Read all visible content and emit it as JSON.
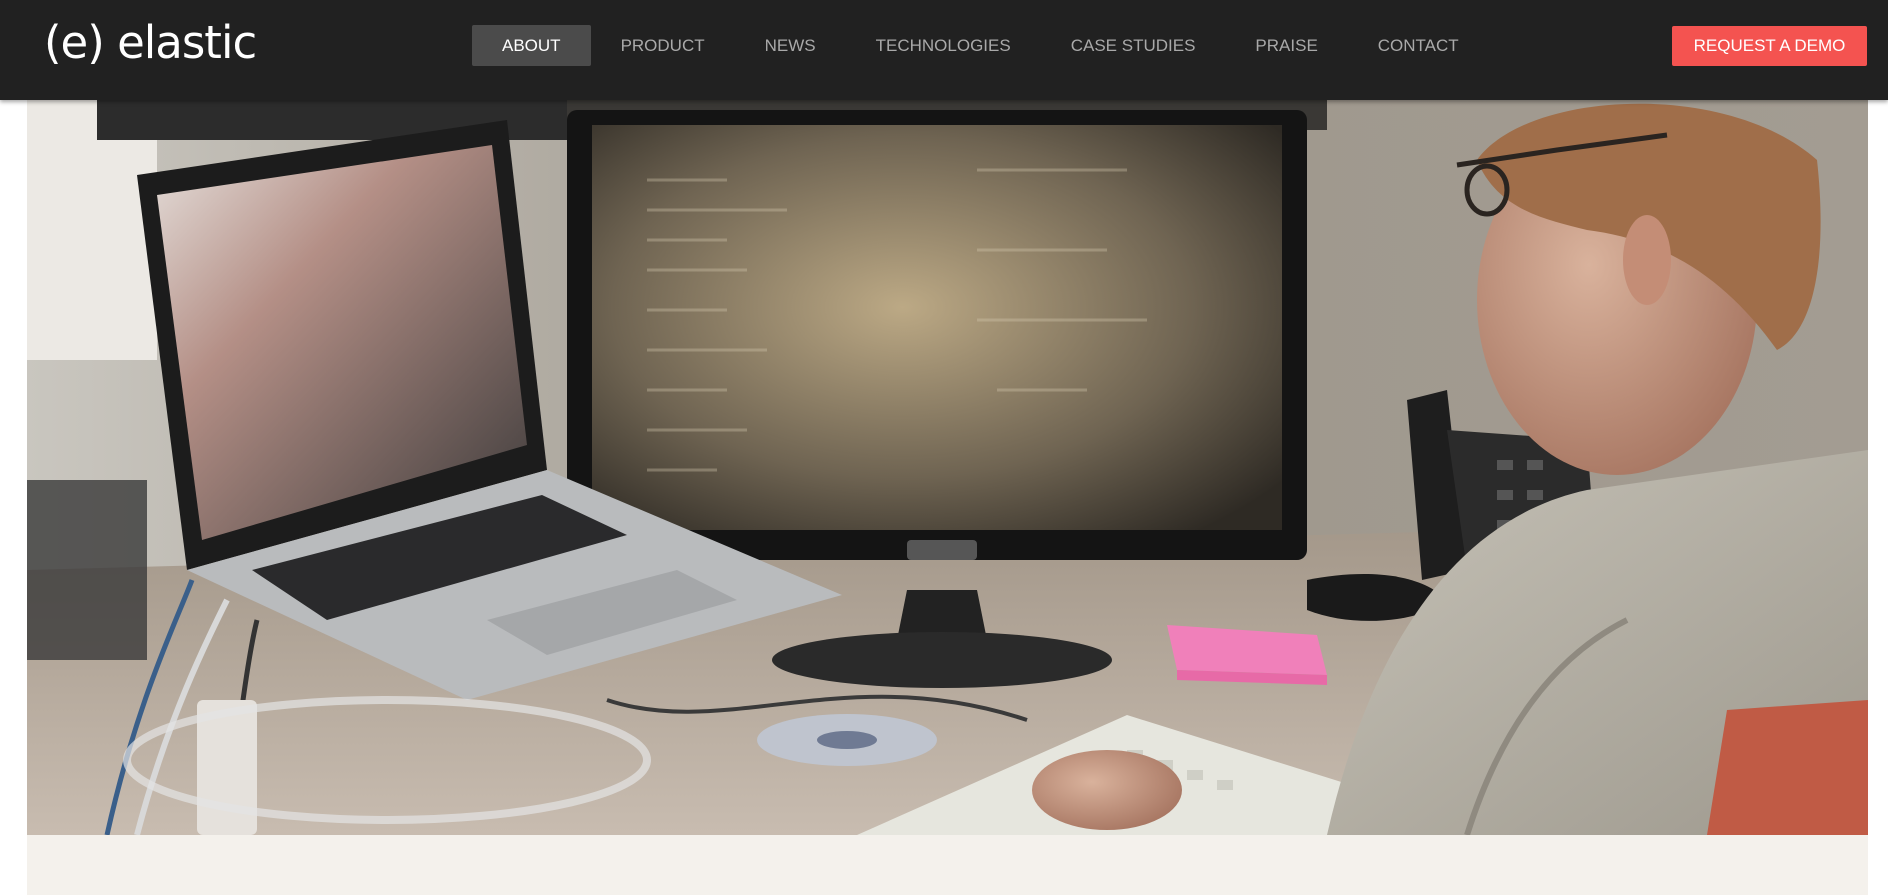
{
  "brand": {
    "logo_text": "(e) elastic"
  },
  "nav": {
    "items": [
      {
        "label": "ABOUT",
        "active": true
      },
      {
        "label": "PRODUCT",
        "active": false
      },
      {
        "label": "NEWS",
        "active": false
      },
      {
        "label": "TECHNOLOGIES",
        "active": false
      },
      {
        "label": "CASE STUDIES",
        "active": false
      },
      {
        "label": "PRAISE",
        "active": false
      },
      {
        "label": "CONTACT",
        "active": false
      }
    ]
  },
  "cta": {
    "label": "REQUEST A DEMO"
  },
  "colors": {
    "topbar": "#212121",
    "nav_active_bg": "#4b4b4b",
    "cta": "#f45350",
    "section_bg": "#f4f1ec"
  },
  "hero": {
    "icon": "office-photo-image"
  }
}
